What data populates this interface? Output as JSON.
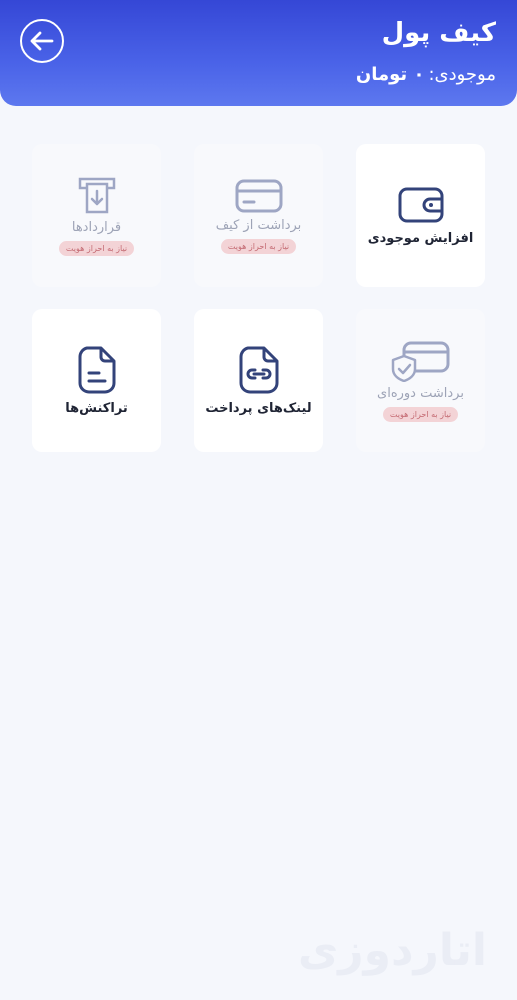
{
  "header": {
    "title": "کیف پول",
    "balance_label": "موجودی:",
    "balance_value": "۰ تومان",
    "back_icon": "arrow-left-icon"
  },
  "cards": [
    {
      "label": "افزایش موجودی",
      "icon": "wallet-icon",
      "enabled": true
    },
    {
      "label": "برداشت از کیف",
      "icon": "credit-card-icon",
      "enabled": false,
      "badge": "نیاز به احراز هویت"
    },
    {
      "label": "قراردادها",
      "icon": "atm-withdraw-icon",
      "enabled": false,
      "badge": "نیاز به احراز هویت"
    },
    {
      "label": "برداشت دوره‌ای",
      "icon": "card-shield-icon",
      "enabled": false,
      "badge": "نیاز به احراز هویت"
    },
    {
      "label": "لینک‌های پرداخت",
      "icon": "document-link-icon",
      "enabled": true
    },
    {
      "label": "تراکنش‌ها",
      "icon": "document-text-icon",
      "enabled": true
    }
  ],
  "watermark": "اتاردوزی",
  "colors": {
    "header_gradient_start": "#3547d6",
    "header_gradient_end": "#5d78ef",
    "icon_active": "#33437a",
    "icon_disabled": "#9ea6c4",
    "badge_bg": "#f3d3d6",
    "badge_text": "#c46a72"
  }
}
